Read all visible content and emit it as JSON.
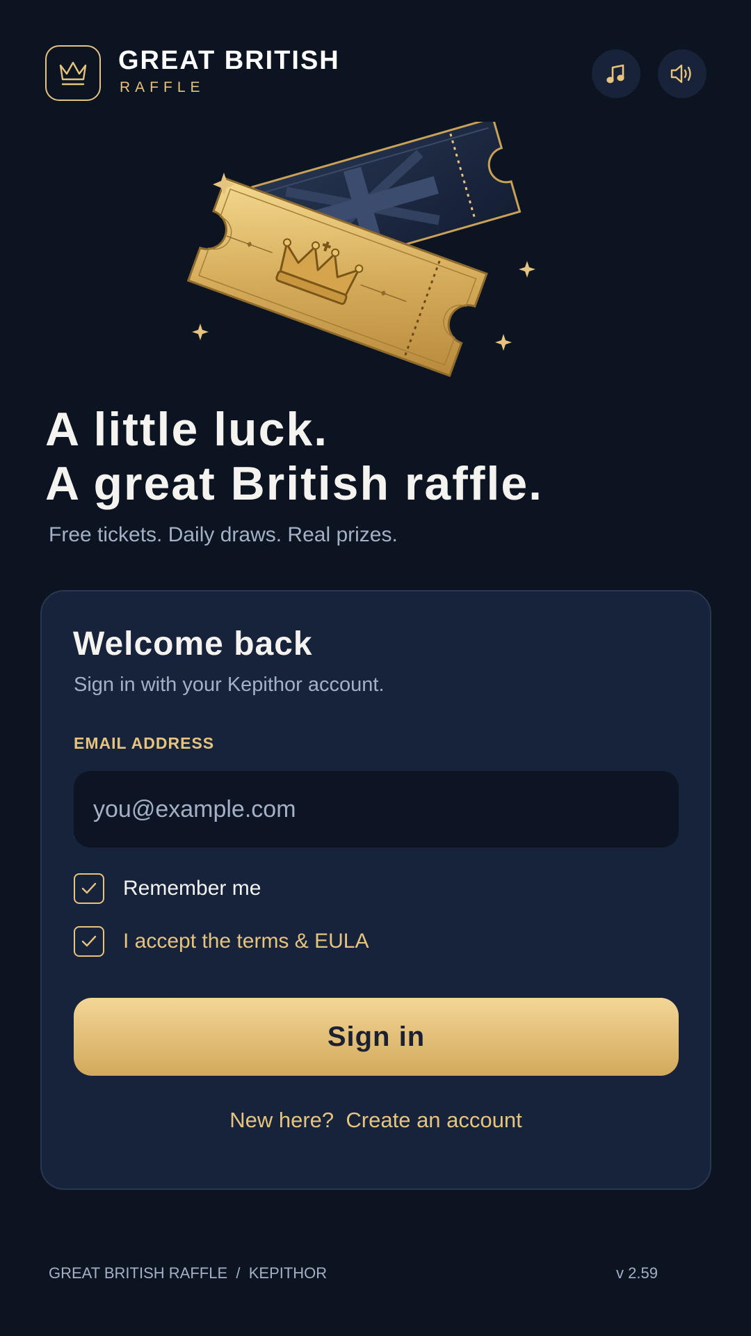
{
  "header": {
    "brand_title": "GREAT BRITISH",
    "brand_subtitle": "RAFFLE",
    "logo_icon": "crown-icon",
    "music_button_icon": "music-note-icon",
    "sound_button_icon": "speaker-icon"
  },
  "hero": {
    "illustration": "golden-crown-ticket-and-union-jack-ticket"
  },
  "headline": {
    "line1": "A little luck.",
    "line2": "A great British raffle."
  },
  "tagline": "Free tickets. Daily draws. Real prizes.",
  "signin_card": {
    "title": "Welcome back",
    "subtitle": "Sign in with your Kepithor account.",
    "email_label": "EMAIL ADDRESS",
    "email_placeholder": "you@example.com",
    "email_value": "",
    "remember_label": "Remember me",
    "remember_checked": true,
    "terms_label": "I accept the terms & EULA",
    "terms_checked": true,
    "submit_label": "Sign in",
    "new_here_text": "New here?",
    "create_account_label": "Create an account"
  },
  "footer": {
    "brand": "GREAT BRITISH RAFFLE",
    "separator": "/",
    "company": "KEPITHOR",
    "version": "v 2.59"
  },
  "colors": {
    "background": "#0c1321",
    "card": "#17233b",
    "accent_gold": "#e6c47f",
    "muted_text": "#a3b0c5"
  }
}
